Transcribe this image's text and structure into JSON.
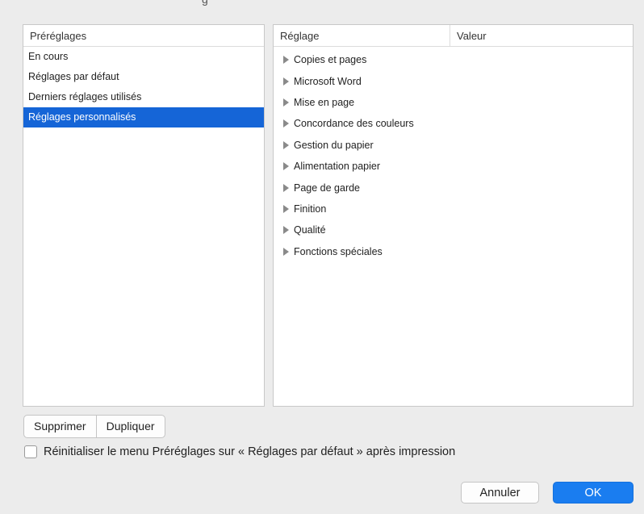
{
  "window": {
    "title_fragment": "g"
  },
  "presets": {
    "header": "Préréglages",
    "items": [
      {
        "label": "En cours",
        "selected": false
      },
      {
        "label": "Réglages par défaut",
        "selected": false
      },
      {
        "label": "Derniers réglages utilisés",
        "selected": false
      },
      {
        "label": "Réglages personnalisés",
        "selected": true
      }
    ]
  },
  "settings": {
    "header_setting": "Réglage",
    "header_value": "Valeur",
    "rows": [
      "Copies et pages",
      "Microsoft Word",
      "Mise en page",
      "Concordance des couleurs",
      "Gestion du papier",
      "Alimentation papier",
      "Page de garde",
      "Finition",
      "Qualité",
      "Fonctions spéciales"
    ],
    "row_icon": "disclosure-triangle-icon"
  },
  "actions": {
    "delete_label": "Supprimer",
    "duplicate_label": "Dupliquer"
  },
  "reset_checkbox": {
    "label": "Réinitialiser le menu Préréglages sur « Réglages par défaut » après impression",
    "checked": false
  },
  "footer": {
    "cancel_label": "Annuler",
    "ok_label": "OK"
  },
  "colors": {
    "selection": "#1565d7",
    "accent_button": "#1a7df0"
  }
}
